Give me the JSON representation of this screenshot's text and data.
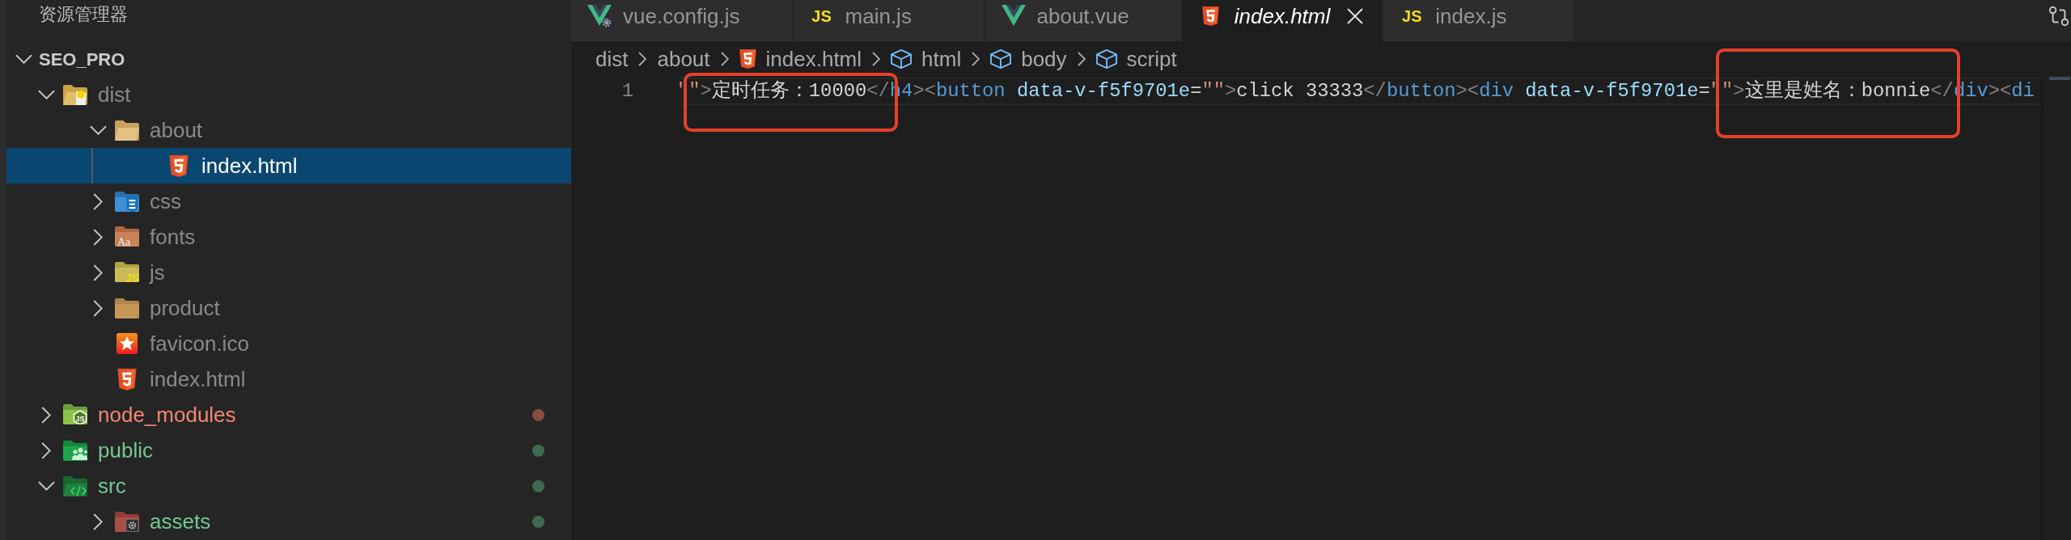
{
  "sidebar": {
    "title": "资源管理器",
    "tree": [
      {
        "label": "SEO_PRO",
        "kind": "root",
        "expanded": true,
        "selected": false,
        "ignored": false,
        "error": false,
        "untracked": false,
        "children": [
          {
            "label": "dist",
            "kind": "dist-folder",
            "expanded": true,
            "selected": false,
            "ignored": true,
            "error": false,
            "untracked": false,
            "children": [
              {
                "label": "about",
                "kind": "folder",
                "expanded": true,
                "selected": false,
                "ignored": true,
                "error": false,
                "untracked": false,
                "children": [
                  {
                    "label": "index.html",
                    "kind": "html",
                    "selected": true,
                    "ignored": true,
                    "error": false,
                    "untracked": false
                  }
                ]
              },
              {
                "label": "css",
                "kind": "css-folder",
                "expanded": false,
                "selected": false,
                "ignored": true,
                "error": false,
                "untracked": false
              },
              {
                "label": "fonts",
                "kind": "fonts-folder",
                "icon_text": "Aa",
                "expanded": false,
                "selected": false,
                "ignored": true,
                "error": false,
                "untracked": false
              },
              {
                "label": "js",
                "kind": "js-folder",
                "icon_text": "JS",
                "expanded": false,
                "selected": false,
                "ignored": true,
                "error": false,
                "untracked": false
              },
              {
                "label": "product",
                "kind": "folder",
                "expanded": false,
                "selected": false,
                "ignored": true,
                "error": false,
                "untracked": false
              },
              {
                "label": "favicon.ico",
                "kind": "favicon",
                "selected": false,
                "ignored": true,
                "error": false,
                "untracked": false
              },
              {
                "label": "index.html",
                "kind": "html",
                "selected": false,
                "ignored": true,
                "error": false,
                "untracked": false
              }
            ]
          },
          {
            "label": "node_modules",
            "kind": "node-folder",
            "icon_text": "JS",
            "expanded": false,
            "selected": false,
            "ignored": false,
            "error": true,
            "untracked": false,
            "color": "#8b4a42"
          },
          {
            "label": "public",
            "kind": "public-folder",
            "expanded": false,
            "selected": false,
            "ignored": false,
            "error": false,
            "untracked": true,
            "color": "#3e6b4f"
          },
          {
            "label": "src",
            "kind": "src-folder",
            "expanded": true,
            "selected": false,
            "ignored": false,
            "error": false,
            "untracked": true,
            "color": "#3e6b4f",
            "children": [
              {
                "label": "assets",
                "kind": "assets-folder",
                "expanded": false,
                "selected": false,
                "ignored": false,
                "error": false,
                "untracked": true,
                "color": "#3e6b4f"
              }
            ]
          }
        ]
      }
    ]
  },
  "tabs": [
    {
      "label": "vue.config.js",
      "kind": "vue-config",
      "selected": false,
      "preview": false
    },
    {
      "label": "main.js",
      "kind": "js",
      "icon_text": "JS",
      "selected": false,
      "preview": false
    },
    {
      "label": "about.vue",
      "kind": "vue",
      "selected": false,
      "preview": false
    },
    {
      "label": "index.html",
      "kind": "html",
      "selected": true,
      "preview": true
    },
    {
      "label": "index.js",
      "kind": "js",
      "icon_text": "JS",
      "selected": false,
      "preview": false
    }
  ],
  "breadcrumbs": [
    {
      "label": "dist",
      "kind": "folder"
    },
    {
      "label": "about",
      "kind": "folder"
    },
    {
      "label": "index.html",
      "kind": "html"
    },
    {
      "label": "html",
      "kind": "symbol"
    },
    {
      "label": "body",
      "kind": "symbol"
    },
    {
      "label": "script",
      "kind": "symbol"
    }
  ],
  "editor": {
    "lines": [
      {
        "number": "1",
        "tokens": [
          {
            "kind": "string",
            "text": "\"\""
          },
          {
            "kind": "punctuation",
            "text": ">"
          },
          {
            "kind": "text",
            "text": "定时任务：10000"
          },
          {
            "kind": "punctuation",
            "text": "</"
          },
          {
            "kind": "tag",
            "text": "h4"
          },
          {
            "kind": "punctuation",
            "text": "><"
          },
          {
            "kind": "tag",
            "text": "button"
          },
          {
            "kind": "attribute",
            "text": " data-v-f5f9701e"
          },
          {
            "kind": "text",
            "text": "="
          },
          {
            "kind": "string",
            "text": "\"\""
          },
          {
            "kind": "punctuation",
            "text": ">"
          },
          {
            "kind": "text",
            "text": "click 33333"
          },
          {
            "kind": "punctuation",
            "text": "</"
          },
          {
            "kind": "tag",
            "text": "button"
          },
          {
            "kind": "punctuation",
            "text": "><"
          },
          {
            "kind": "tag",
            "text": "div"
          },
          {
            "kind": "attribute",
            "text": " data-v-f5f9701e"
          },
          {
            "kind": "text",
            "text": "="
          },
          {
            "kind": "string",
            "text": "\"\""
          },
          {
            "kind": "punctuation",
            "text": ">"
          },
          {
            "kind": "text",
            "text": "这里是姓名：bonnie"
          },
          {
            "kind": "punctuation",
            "text": "</"
          },
          {
            "kind": "tag",
            "text": "div"
          },
          {
            "kind": "punctuation",
            "text": "><"
          },
          {
            "kind": "tag",
            "text": "di"
          }
        ]
      }
    ]
  },
  "annotations": [
    {
      "kind": "rectangle"
    },
    {
      "kind": "rectangle"
    }
  ]
}
